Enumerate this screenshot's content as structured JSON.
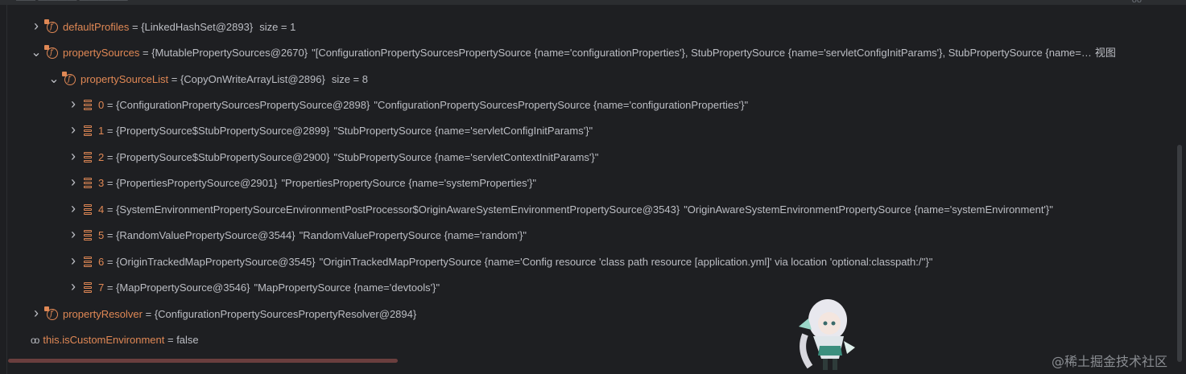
{
  "top_strip": {
    "left_fragment": "—— ———— —————",
    "right_fragment": "oo"
  },
  "tree": {
    "default_profiles": {
      "name": "defaultProfiles",
      "value": "{LinkedHashSet@2893}",
      "extra": "size = 1"
    },
    "property_sources": {
      "name": "propertySources",
      "value": "{MutablePropertySources@2670}",
      "extra": "\"[ConfigurationPropertySourcesPropertySource {name='configurationProperties'}, StubPropertySource {name='servletConfigInitParams'}, StubPropertySource {name=…",
      "view_link": "视图"
    },
    "property_source_list": {
      "name": "propertySourceList",
      "value": "{CopyOnWriteArrayList@2896}",
      "extra": "size = 8"
    },
    "items": [
      {
        "index": "0",
        "value": "{ConfigurationPropertySourcesPropertySource@2898}",
        "str": "\"ConfigurationPropertySourcesPropertySource {name='configurationProperties'}\""
      },
      {
        "index": "1",
        "value": "{PropertySource$StubPropertySource@2899}",
        "str": "\"StubPropertySource {name='servletConfigInitParams'}\""
      },
      {
        "index": "2",
        "value": "{PropertySource$StubPropertySource@2900}",
        "str": "\"StubPropertySource {name='servletContextInitParams'}\""
      },
      {
        "index": "3",
        "value": "{PropertiesPropertySource@2901}",
        "str": "\"PropertiesPropertySource {name='systemProperties'}\""
      },
      {
        "index": "4",
        "value": "{SystemEnvironmentPropertySourceEnvironmentPostProcessor$OriginAwareSystemEnvironmentPropertySource@3543}",
        "str": "\"OriginAwareSystemEnvironmentPropertySource {name='systemEnvironment'}\""
      },
      {
        "index": "5",
        "value": "{RandomValuePropertySource@3544}",
        "str": "\"RandomValuePropertySource {name='random'}\""
      },
      {
        "index": "6",
        "value": "{OriginTrackedMapPropertySource@3545}",
        "str": "\"OriginTrackedMapPropertySource {name='Config resource 'class path resource [application.yml]' via location 'optional:classpath:/''}\""
      },
      {
        "index": "7",
        "value": "{MapPropertySource@3546}",
        "str": "\"MapPropertySource {name='devtools'}\""
      }
    ],
    "property_resolver": {
      "name": "propertyResolver",
      "value": "{ConfigurationPropertySourcesPropertyResolver@2894}"
    },
    "is_custom_environment": {
      "name": "this.isCustomEnvironment",
      "value": "false"
    }
  },
  "watermark": "@稀土掘金技术社区",
  "icons": {
    "expand": "chevron-right-icon",
    "collapse": "chevron-down-icon",
    "field": "field-icon",
    "array_item": "array-item-icon",
    "watch": "watch-glasses-icon"
  },
  "colors": {
    "background": "#1e1f22",
    "name": "#e08855",
    "text": "#bcbec4"
  }
}
